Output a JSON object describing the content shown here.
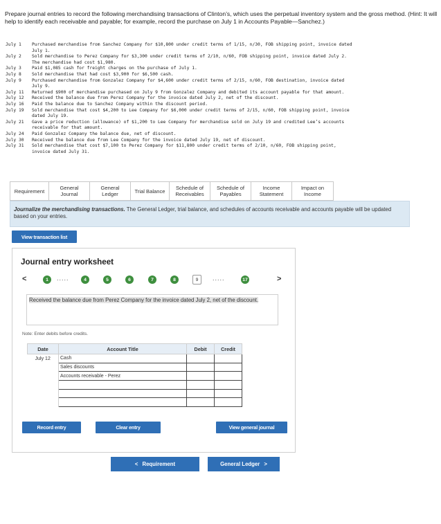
{
  "instructions": "Prepare journal entries to record the following merchandising transactions of Clinton’s, which uses the perpetual inventory system and the gross method. (Hint: It will help to identify each receivable and payable; for example, record the purchase on July 1 in Accounts Payable—Sanchez.)",
  "transactions": [
    {
      "date": "July 1",
      "text": "Purchased merchandise from Sanchez Company for $10,800 under credit terms of 1/15, n/30, FOB shipping point, invoice dated",
      "cont": "July 1."
    },
    {
      "date": "July 2",
      "text": "Sold merchandise to Perez Company for $3,300 under credit terms of 2/10, n/60, FOB shipping point, invoice dated July 2.",
      "cont": "The merchandise had cost $1,980."
    },
    {
      "date": "July 3",
      "text": "Paid $1,085 cash for freight charges on the purchase of July 1.",
      "cont": ""
    },
    {
      "date": "July 8",
      "text": "Sold merchandise that had cost $3,900 for $6,500 cash.",
      "cont": ""
    },
    {
      "date": "July 9",
      "text": "Purchased merchandise from Gonzalez Company for $4,600 under credit terms of 2/15, n/60, FOB destination, invoice dated",
      "cont": "July 9."
    },
    {
      "date": "July 11",
      "text": "Returned $900 of merchandise purchased on July 9 from Gonzalez Company and debited its account payable for that amount.",
      "cont": ""
    },
    {
      "date": "July 12",
      "text": "Received the balance due from Perez Company for the invoice dated July 2, net of the discount.",
      "cont": ""
    },
    {
      "date": "July 16",
      "text": "Paid the balance due to Sanchez Company within the discount period.",
      "cont": ""
    },
    {
      "date": "July 19",
      "text": "Sold merchandise that cost $4,200 to Lee Company for $6,000 under credit terms of 2/15, n/60, FOB shipping point, invoice",
      "cont": "dated July 19."
    },
    {
      "date": "July 21",
      "text": "Gave a price reduction (allowance) of $1,200 to Lee Company for merchandise sold on July 19 and credited Lee’s accounts",
      "cont": "receivable for that amount."
    },
    {
      "date": "July 24",
      "text": "Paid Gonzalez Company the balance due, net of discount.",
      "cont": ""
    },
    {
      "date": "July 30",
      "text": "Received the balance due from Lee Company for the invoice dated July 19, net of discount.",
      "cont": ""
    },
    {
      "date": "July 31",
      "text": "Sold merchandise that cost $7,100 to Perez Company for $11,800 under credit terms of 2/10, n/60, FOB shipping point,",
      "cont": "invoice dated July 31."
    }
  ],
  "tabs": [
    {
      "label": "Requirement"
    },
    {
      "label": "General Journal"
    },
    {
      "label": "General Ledger"
    },
    {
      "label": "Trial Balance"
    },
    {
      "label": "Schedule of Receivables"
    },
    {
      "label": "Schedule of Payables"
    },
    {
      "label": "Income Statement"
    },
    {
      "label": "Impact on Income"
    }
  ],
  "banner": {
    "bold": "Journalize the merchandising transactions.",
    "rest": " The General Ledger, trial balance, and schedules of accounts receivable and accounts payable will be updated based on your entries."
  },
  "view_transaction_list_label": "View transaction list",
  "worksheet": {
    "title": "Journal entry worksheet",
    "nav": {
      "prev": "<",
      "next": ">",
      "ellipsis": ".....",
      "steps": [
        "1",
        "4",
        "5",
        "6",
        "7",
        "8",
        "9",
        "17"
      ],
      "current": "9"
    },
    "description": "Received the balance due from Perez Company for the invoice dated July 2, net of the discount.",
    "note": "Note: Enter debits before credits.",
    "headers": {
      "date": "Date",
      "account": "Account Title",
      "debit": "Debit",
      "credit": "Credit"
    },
    "rows": [
      {
        "date": "July 12",
        "account": "Cash",
        "debit": "",
        "credit": ""
      },
      {
        "date": "",
        "account": "Sales discounts",
        "debit": "",
        "credit": ""
      },
      {
        "date": "",
        "account": "Accounts receivable - Perez",
        "debit": "",
        "credit": ""
      },
      {
        "date": "",
        "account": "",
        "debit": "",
        "credit": ""
      },
      {
        "date": "",
        "account": "",
        "debit": "",
        "credit": ""
      },
      {
        "date": "",
        "account": "",
        "debit": "",
        "credit": ""
      }
    ],
    "record_entry_label": "Record entry",
    "clear_entry_label": "Clear entry",
    "view_general_journal_label": "View general journal"
  },
  "bottom_nav": {
    "prev_label": "Requirement",
    "next_label": "General Ledger",
    "prev_arrow": "<",
    "next_arrow": ">"
  },
  "colors": {
    "accent": "#2f6fb6",
    "step_done": "#3e8f3e",
    "banner_bg": "#dce9f3"
  }
}
